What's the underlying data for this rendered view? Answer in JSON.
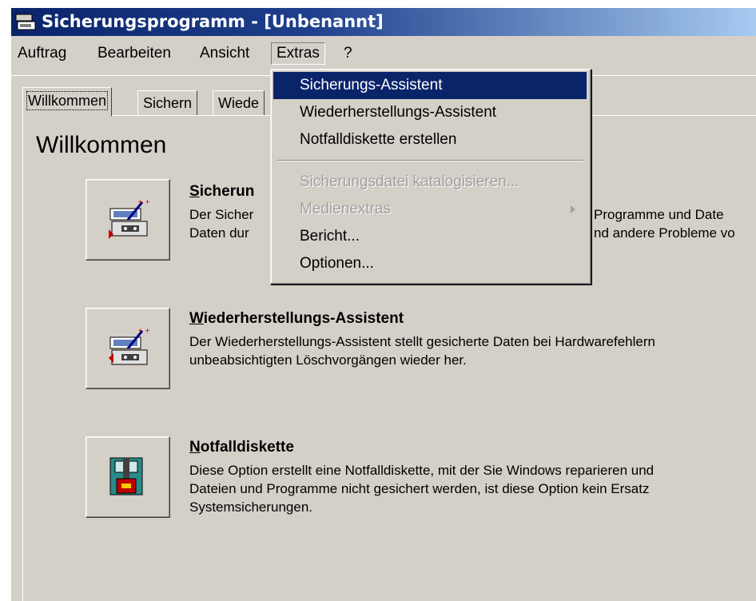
{
  "window": {
    "title": "Sicherungsprogramm - [Unbenannt]"
  },
  "menubar": {
    "items": [
      {
        "label": "Auftrag"
      },
      {
        "label": "Bearbeiten"
      },
      {
        "label": "Ansicht"
      },
      {
        "label": "Extras"
      },
      {
        "label": "?"
      }
    ]
  },
  "tabs": [
    {
      "label": "Willkommen"
    },
    {
      "label": "Sichern"
    },
    {
      "label": "Wiede"
    }
  ],
  "main": {
    "title": "Willkommen",
    "sections": [
      {
        "heading_u": "S",
        "heading_rest": "icherun",
        "line1": "Der Sicher",
        "line2": "Daten dur",
        "line1_end": "Programme und Date",
        "line2_end": "nd andere Probleme vo",
        "icon": "backup-wizard-icon"
      },
      {
        "heading_u": "W",
        "heading_rest": "iederherstellungs-Assistent",
        "line1": "Der Wiederherstellungs-Assistent stellt gesicherte Daten bei Hardwarefehlern",
        "line2": "unbeabsichtigten Löschvorgängen wieder her.",
        "icon": "restore-wizard-icon"
      },
      {
        "heading_u": "N",
        "heading_rest": "otfalldiskette",
        "line1": "Diese Option erstellt eine Notfalldiskette, mit der Sie Windows reparieren und",
        "line2": "Dateien und Programme nicht gesichert werden, ist diese Option kein Ersatz",
        "line3": "Systemsicherungen.",
        "icon": "emergency-disk-icon"
      }
    ]
  },
  "dropdown": {
    "items": [
      {
        "label": "Sicherungs-Assistent",
        "state": "highlighted"
      },
      {
        "label": "Wiederherstellungs-Assistent",
        "state": "enabled"
      },
      {
        "label": "Notfalldiskette erstellen",
        "state": "enabled"
      },
      {
        "label": "Sicherungsdatei katalogisieren...",
        "state": "disabled"
      },
      {
        "label": "Medienextras",
        "state": "disabled",
        "submenu": true
      },
      {
        "label": "Bericht...",
        "state": "enabled"
      },
      {
        "label": "Optionen...",
        "state": "enabled"
      }
    ]
  },
  "colors": {
    "highlight": "#0a246a",
    "face": "#d4d0c8",
    "disabled_text": "#a0a0a0"
  }
}
